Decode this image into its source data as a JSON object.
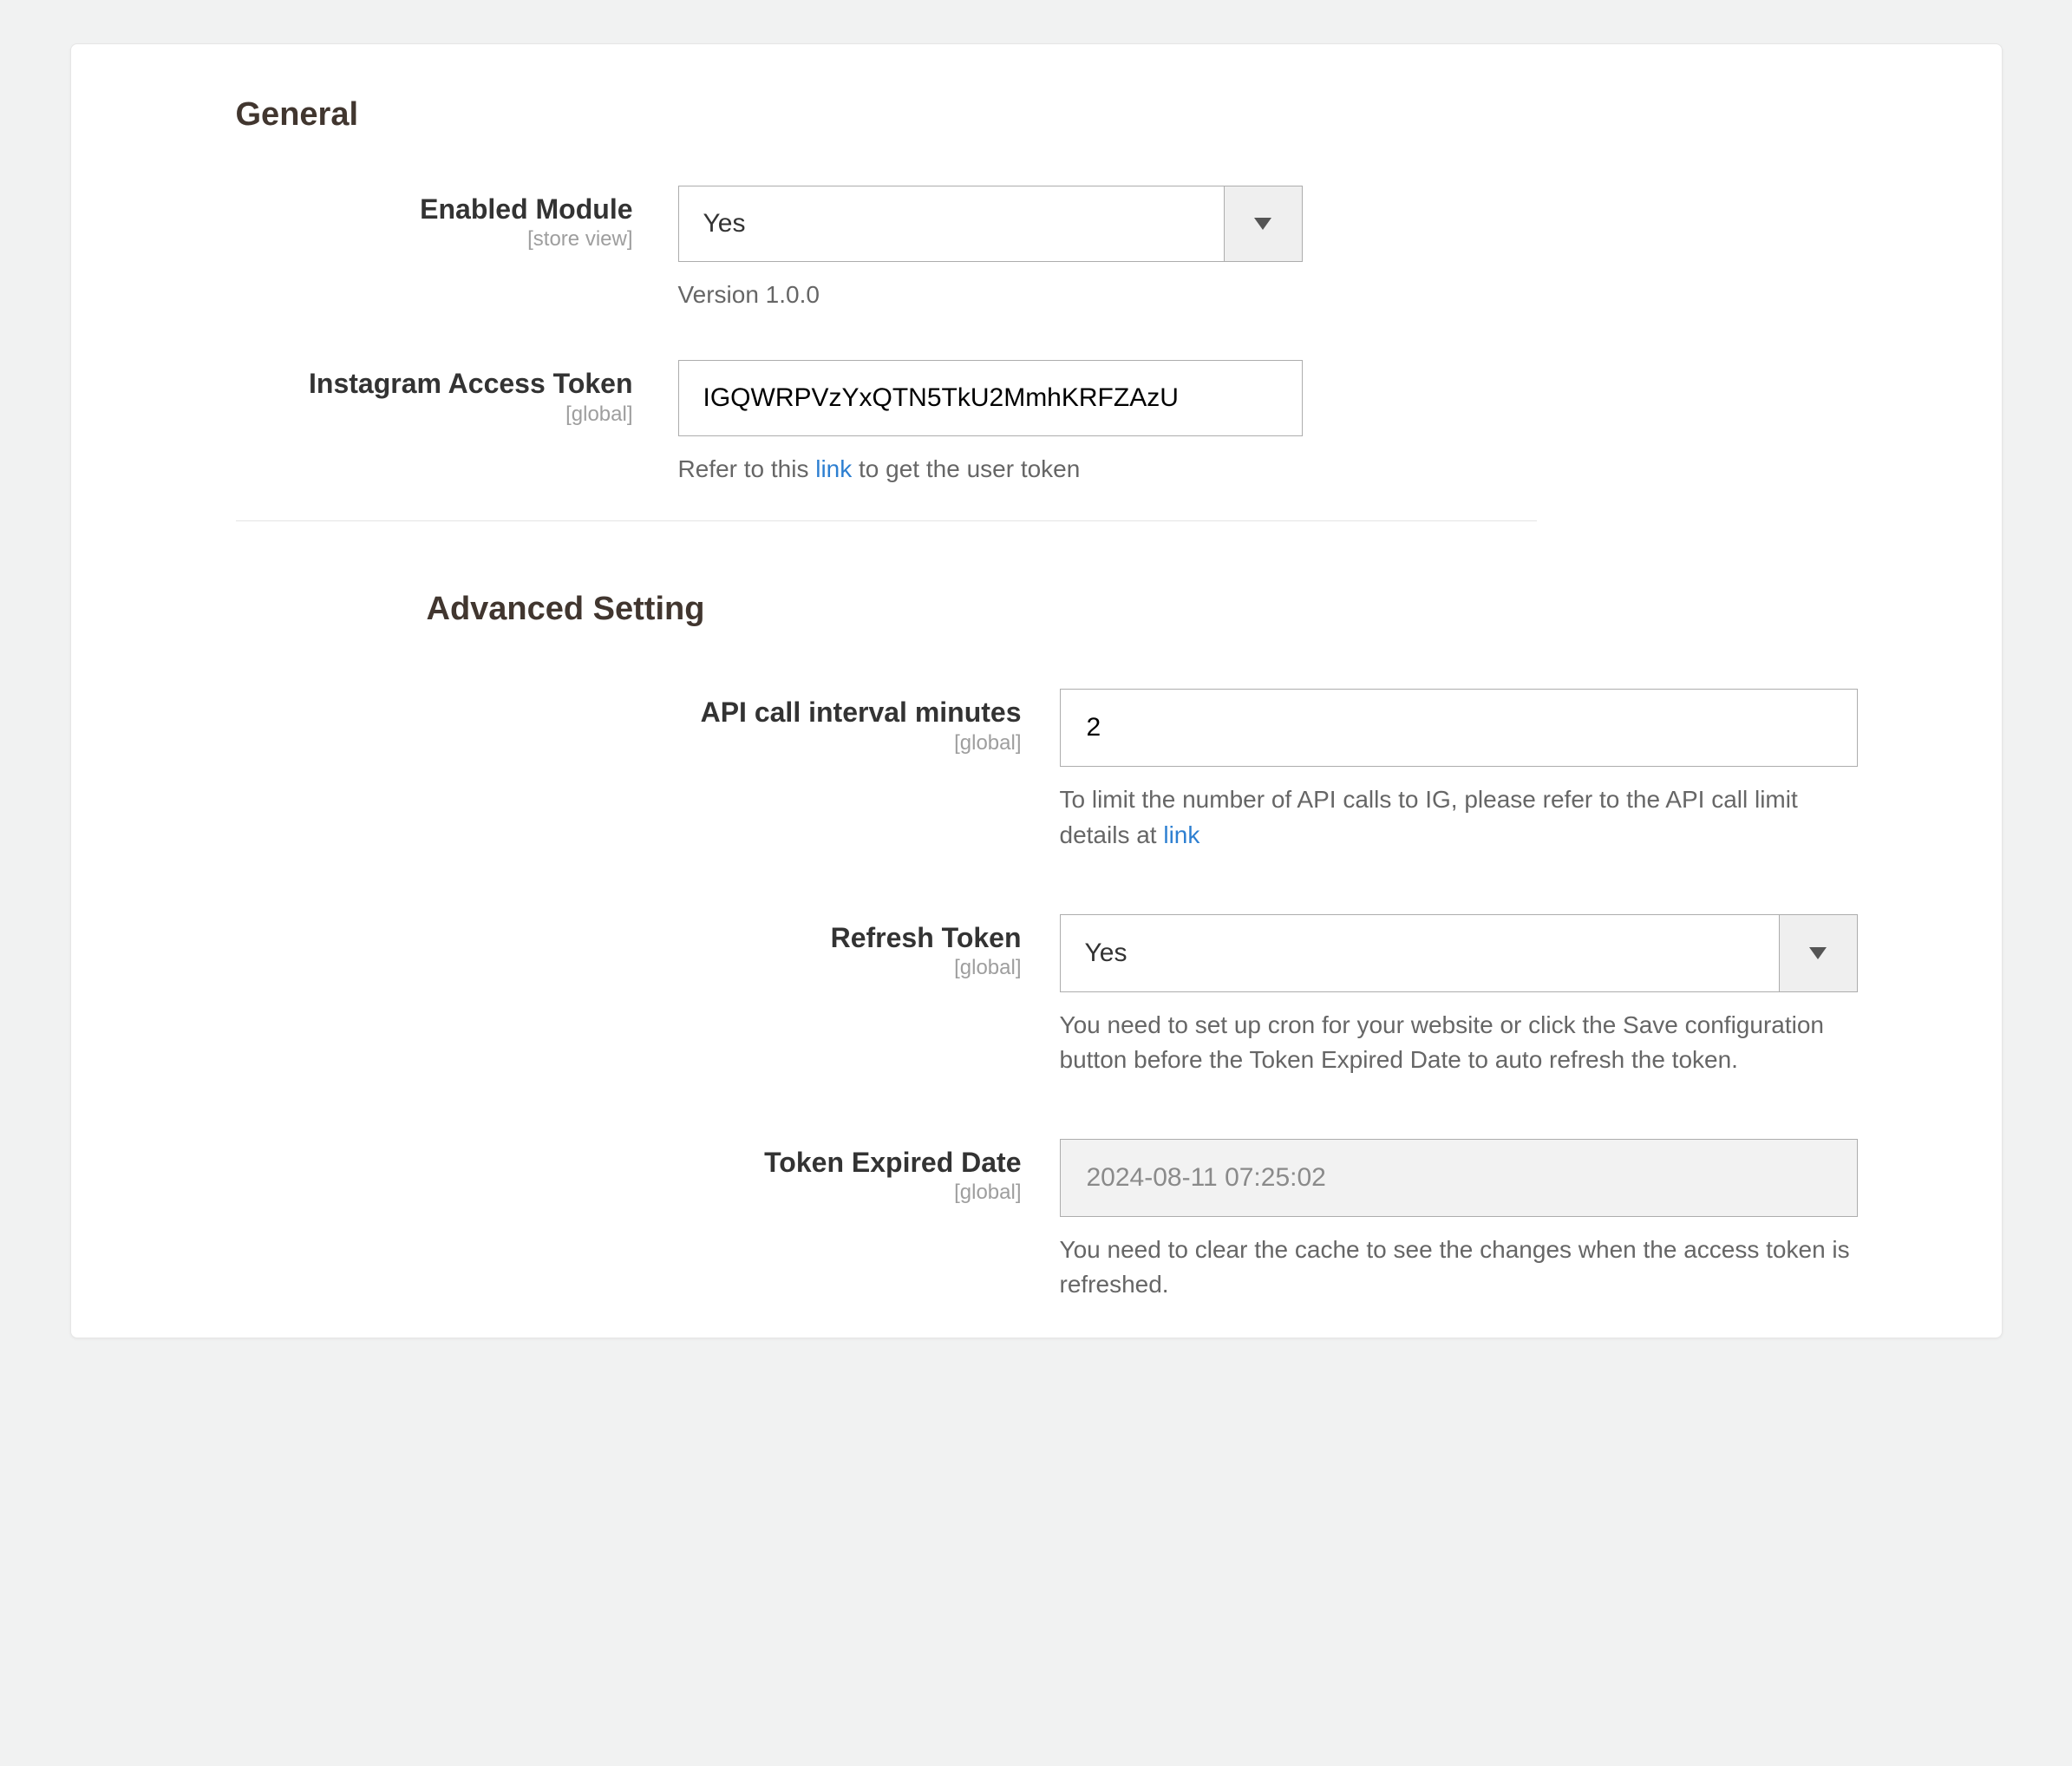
{
  "general": {
    "heading": "General",
    "enabled_module": {
      "label": "Enabled Module",
      "scope": "[store view]",
      "value": "Yes",
      "help": "Version 1.0.0"
    },
    "access_token": {
      "label": "Instagram Access Token",
      "scope": "[global]",
      "value": "IGQWRPVzYxQTN5TkU2MmhKRFZAzU",
      "help_prefix": "Refer to this ",
      "link_text": "link",
      "help_suffix": " to get the user token"
    }
  },
  "advanced": {
    "heading": "Advanced Setting",
    "api_interval": {
      "label": "API call interval minutes",
      "scope": "[global]",
      "value": "2",
      "help_prefix": "To limit the number of API calls to IG, please refer to the API call limit details at ",
      "link_text": "link"
    },
    "refresh_token": {
      "label": "Refresh Token",
      "scope": "[global]",
      "value": "Yes",
      "help": "You need to set up cron for your website or click the Save configuration button before the Token Expired Date to auto refresh the token."
    },
    "token_expired": {
      "label": "Token Expired Date",
      "scope": "[global]",
      "value": "2024-08-11 07:25:02",
      "help": "You need to clear the cache to see the changes when the access token is refreshed."
    }
  }
}
